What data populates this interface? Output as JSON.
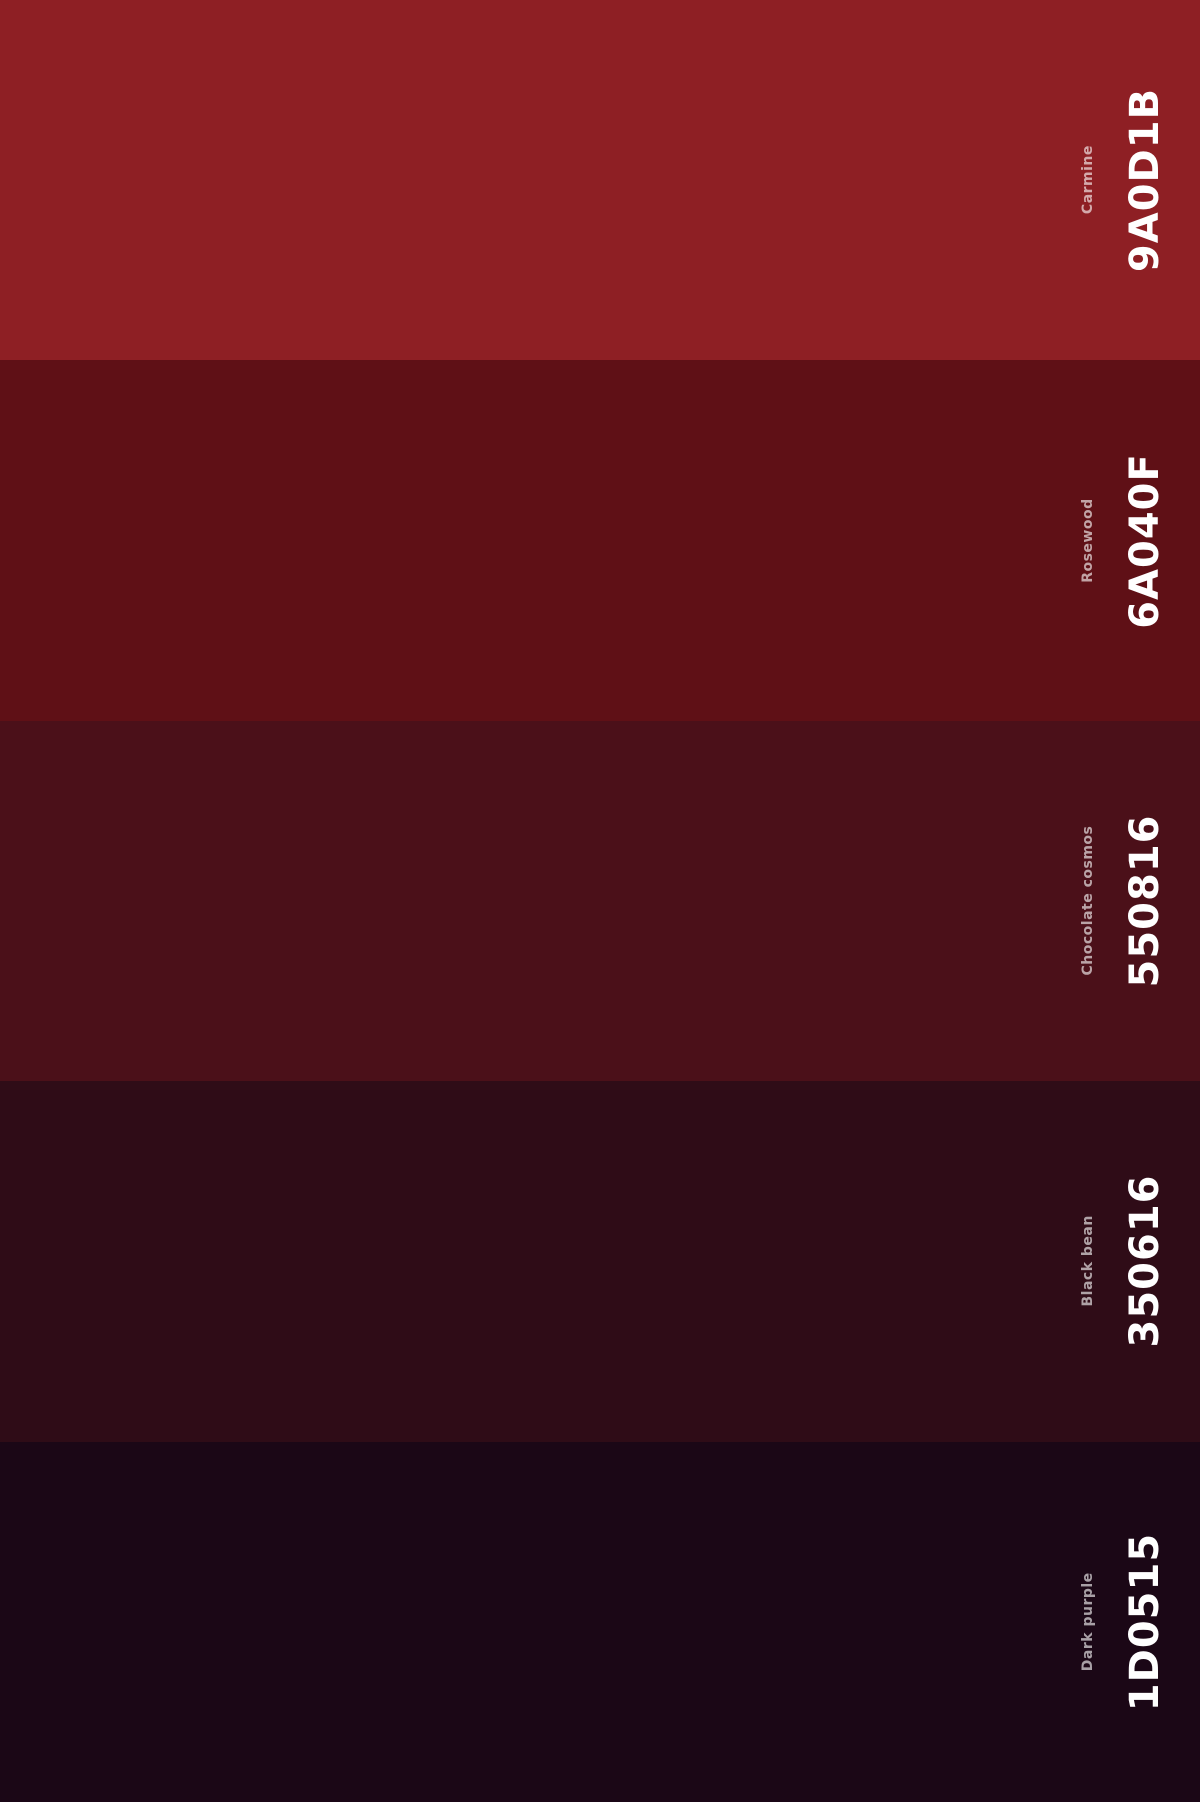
{
  "palette": {
    "swatches": [
      {
        "hex": "9A0D1B",
        "name": "Carmine",
        "color": "#8e1f24"
      },
      {
        "hex": "6A040F",
        "name": "Rosewood",
        "color": "#5f1016"
      },
      {
        "hex": "550816",
        "name": "Chocolate cosmos",
        "color": "#4b1019"
      },
      {
        "hex": "350616",
        "name": "Black bean",
        "color": "#2f0c17"
      },
      {
        "hex": "1D0515",
        "name": "Dark purple",
        "color": "#1b0716"
      }
    ]
  }
}
